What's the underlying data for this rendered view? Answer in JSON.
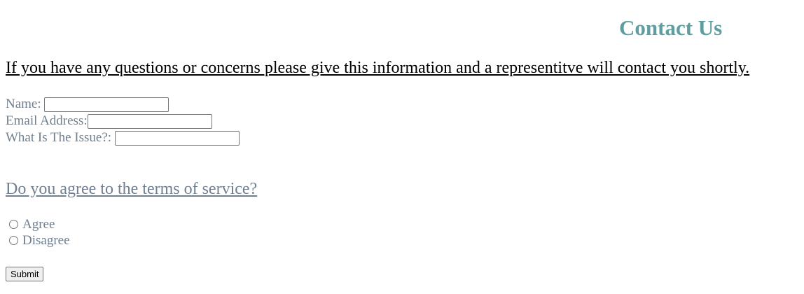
{
  "header": {
    "title": "Contact Us"
  },
  "intro": {
    "text": "If you have any questions or concerns please give this information and a representitve will contact you shortly."
  },
  "form": {
    "fields": [
      {
        "label": "Name: ",
        "value": ""
      },
      {
        "label": "Email Address:",
        "value": ""
      },
      {
        "label": "What Is The Issue?: ",
        "value": ""
      }
    ],
    "terms": {
      "question": "Do you agree to the terms of service?",
      "options": [
        {
          "label": "Agree",
          "selected": false
        },
        {
          "label": "Disagree",
          "selected": false
        }
      ]
    },
    "submit_label": "Submit"
  }
}
